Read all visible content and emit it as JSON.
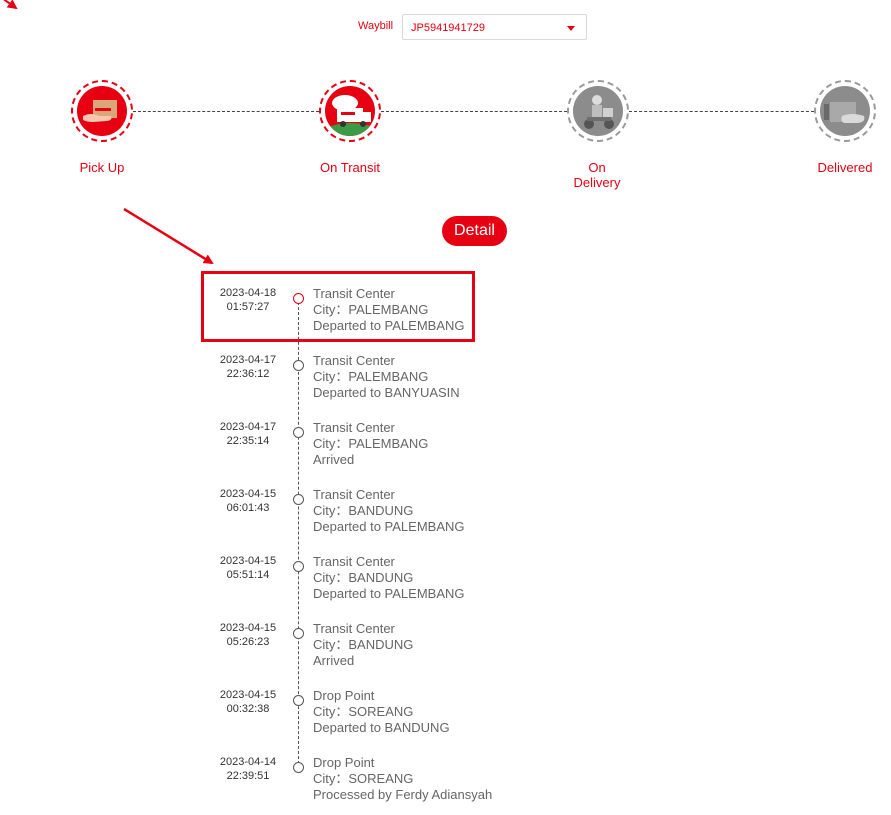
{
  "waybill": {
    "label": "Waybill",
    "value": "JP5941941729"
  },
  "steps": [
    {
      "label": "Pick Up",
      "state": "done"
    },
    {
      "label": "On Transit",
      "state": "done"
    },
    {
      "label_line1": "On",
      "label_line2": "Delivery",
      "state": "pending"
    },
    {
      "label": "Delivered",
      "state": "pending"
    }
  ],
  "detail_button": "Detail",
  "events": [
    {
      "date": "2023-04-18",
      "time": "01:57:27",
      "type": "Transit Center",
      "city": "City：PALEMBANG",
      "status": "Departed to PALEMBANG",
      "active": true
    },
    {
      "date": "2023-04-17",
      "time": "22:36:12",
      "type": "Transit Center",
      "city": "City：PALEMBANG",
      "status": "Departed to BANYUASIN"
    },
    {
      "date": "2023-04-17",
      "time": "22:35:14",
      "type": "Transit Center",
      "city": "City：PALEMBANG",
      "status": "Arrived"
    },
    {
      "date": "2023-04-15",
      "time": "06:01:43",
      "type": "Transit Center",
      "city": "City：BANDUNG",
      "status": "Departed to PALEMBANG"
    },
    {
      "date": "2023-04-15",
      "time": "05:51:14",
      "type": "Transit Center",
      "city": "City：BANDUNG",
      "status": "Departed to PALEMBANG"
    },
    {
      "date": "2023-04-15",
      "time": "05:26:23",
      "type": "Transit Center",
      "city": "City：BANDUNG",
      "status": "Arrived"
    },
    {
      "date": "2023-04-15",
      "time": "00:32:38",
      "type": "Drop Point",
      "city": "City：SOREANG",
      "status": "Departed to BANDUNG"
    },
    {
      "date": "2023-04-14",
      "time": "22:39:51",
      "type": "Drop Point",
      "city": "City：SOREANG",
      "status": "Processed by Ferdy Adiansyah"
    }
  ],
  "colors": {
    "accent": "#e60012",
    "inactive": "#8c8c8c"
  }
}
